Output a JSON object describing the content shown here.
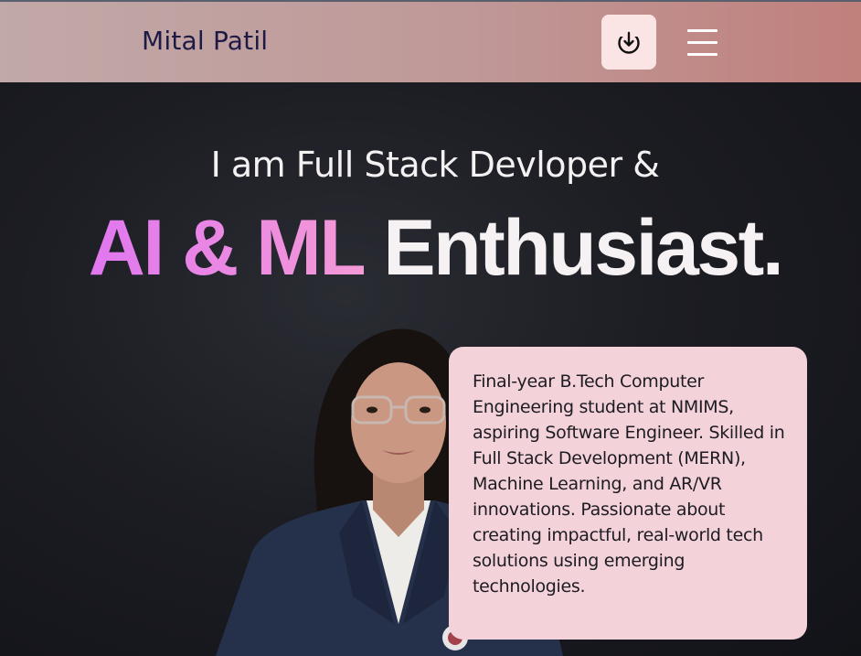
{
  "nav": {
    "brand": "Mital Patil",
    "download_icon": "download-icon",
    "menu_icon": "hamburger-menu-icon"
  },
  "hero": {
    "subtitle": "I am Full Stack Devloper &",
    "title_accent": "AI & ML",
    "title_rest": "Enthusiast."
  },
  "about": {
    "text": "Final-year B.Tech Computer Engineering student at NMIMS, aspiring Software Engineer. Skilled in Full Stack Development (MERN), Machine Learning, and AR/VR innovations. Passionate about creating impactful, real-world tech solutions using emerging technologies."
  },
  "colors": {
    "nav_gradient_start": "#c1a9a8",
    "nav_gradient_end": "#c0807c",
    "brand_text": "#1e1a45",
    "accent_gradient_start": "#e077f0",
    "accent_gradient_end": "#f49ad6",
    "card_bg": "#f4d2da",
    "background": "#1c1d23"
  }
}
